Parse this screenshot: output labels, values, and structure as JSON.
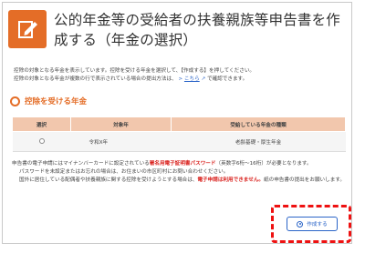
{
  "page": {
    "title": "公的年金等の受給者の扶養親族等申告書を作成する（年金の選択）",
    "title_icon": "edit-document-icon",
    "accent_color": "#e46d27",
    "highlight_color": "#ee1111",
    "link_color": "#2a64c8"
  },
  "intro": {
    "line1": "控除の対象となる年金を表示しています。控除を受ける年金を選択して、【作成する】を押してください。",
    "line2_prefix": "控除の対象となる年金が複数の行で表示されている場合の提出方法は、",
    "link_marker": ">",
    "link_text": "こちら",
    "line2_suffix": "で確認できます。"
  },
  "section": {
    "title": "控除を受ける年金"
  },
  "table": {
    "headers": [
      "選択",
      "対象年",
      "受給している年金の種類"
    ],
    "rows": [
      {
        "selected": false,
        "year": "令和X年",
        "pension_type": "老齢基礎・厚生年金"
      }
    ]
  },
  "notes": {
    "line1_pre": "申告書の電子申請にはマイナンバーカードに設定されている",
    "line1_red": "署名用電子証明書パスワード",
    "line1_post": "（英数字6桁〜16桁）が必要となります。",
    "line2": "パスワードを未設定またはお忘れの場合は、お住まいの市区町村にお問い合わせください。",
    "line3_pre": "国外に居住している配偶者や扶養親族に関する控除を受けようとする場合は、",
    "line3_red": "電子申請は利用できません。",
    "line3_post": "紙の申告書の提出をお願いします。"
  },
  "actions": {
    "create_label": "作成する"
  }
}
